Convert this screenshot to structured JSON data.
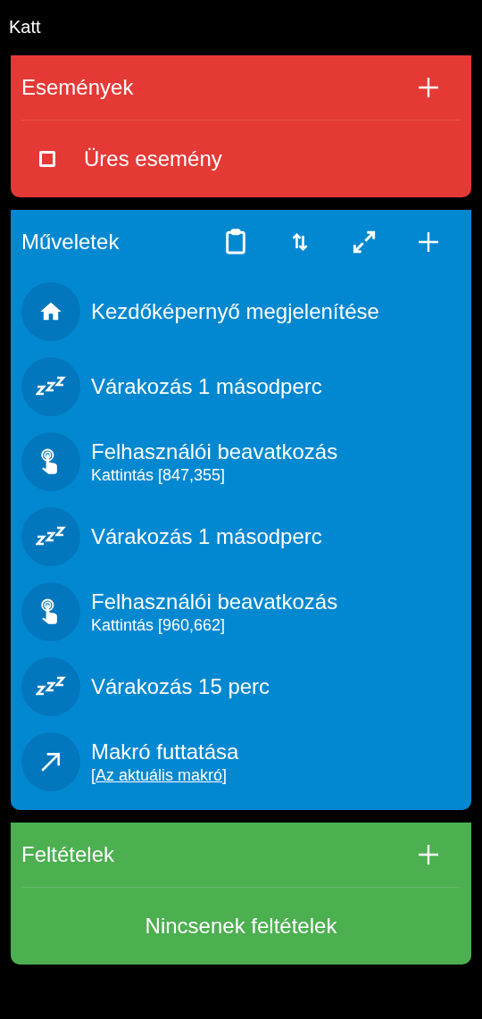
{
  "title": "Katt",
  "events": {
    "title": "Események",
    "items": [
      {
        "label": "Üres esemény",
        "checked": false
      }
    ]
  },
  "actions": {
    "title": "Műveletek",
    "toolbar": [
      {
        "kind": "clipboard"
      },
      {
        "kind": "reorder"
      },
      {
        "kind": "expand"
      },
      {
        "kind": "add"
      }
    ],
    "items": [
      {
        "kind": "home",
        "label": "Kezdőképernyő megjelenítése"
      },
      {
        "kind": "wait",
        "label": "Várakozás 1 másodperc"
      },
      {
        "kind": "tap",
        "label": "Felhasználói beavatkozás",
        "detail": "Kattintás [847,355]",
        "detail_link": false
      },
      {
        "kind": "wait",
        "label": "Várakozás 1 másodperc"
      },
      {
        "kind": "tap",
        "label": "Felhasználói beavatkozás",
        "detail": "Kattintás [960,662]",
        "detail_link": false
      },
      {
        "kind": "wait",
        "label": "Várakozás 15 perc"
      },
      {
        "kind": "macro",
        "label": "Makró futtatása",
        "detail": "[Az aktuális makró]",
        "detail_link": true
      }
    ]
  },
  "conditions": {
    "title": "Feltételek",
    "empty_text": "Nincsenek feltételek"
  }
}
